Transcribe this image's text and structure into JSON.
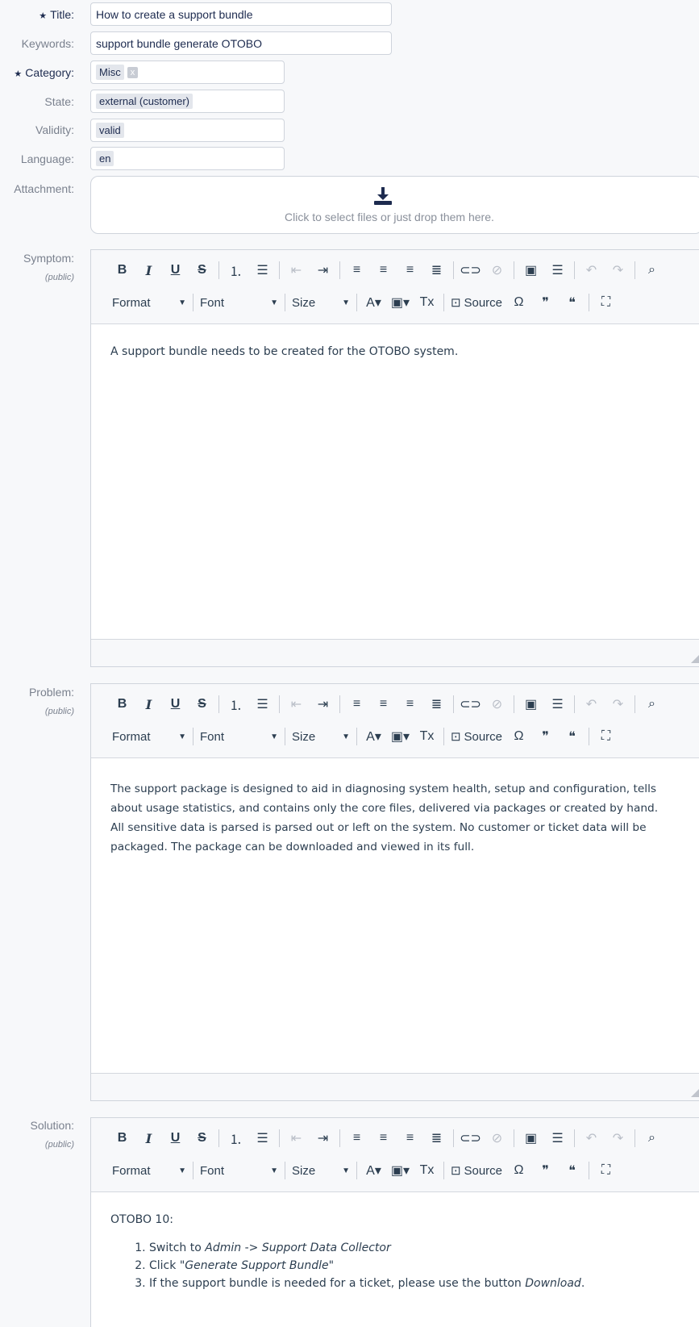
{
  "fields": {
    "title": {
      "label": "Title:",
      "required": true,
      "value": "How to create a support bundle"
    },
    "keywords": {
      "label": "Keywords:",
      "value": "support bundle generate OTOBO"
    },
    "category": {
      "label": "Category:",
      "required": true,
      "tag": "Misc",
      "remove": "x"
    },
    "state": {
      "label": "State:",
      "tag": "external (customer)"
    },
    "validity": {
      "label": "Validity:",
      "tag": "valid"
    },
    "language": {
      "label": "Language:",
      "tag": "en"
    },
    "attachment": {
      "label": "Attachment:",
      "hint": "Click to select files or just drop them here."
    }
  },
  "star": "★",
  "toolbar": {
    "format": "Format",
    "font": "Font",
    "size": "Size",
    "source": "Source",
    "bold": "B",
    "italic": "I",
    "underline": "U",
    "strike": "S",
    "omega": "Ω"
  },
  "editors": {
    "symptom": {
      "label": "Symptom:",
      "visibility": "(public)",
      "text": "A support bundle needs to be created for the OTOBO system."
    },
    "problem": {
      "label": "Problem:",
      "visibility": "(public)",
      "lines": [
        "The support package is designed to aid in diagnosing system health, setup and configuration, tells",
        "about usage statistics, and contains only the core files, delivered via packages or created by hand.",
        "All sensitive data is parsed is parsed out or left on the system. No customer or ticket data will be",
        "packaged. The package can be downloaded and viewed in its full."
      ]
    },
    "solution": {
      "label": "Solution:",
      "visibility": "(public)",
      "heading": "OTOBO 10:",
      "steps": [
        {
          "pre": "Switch to ",
          "em": "Admin",
          "mid": " -> ",
          "em2": "Support Data Collector",
          "post": ""
        },
        {
          "pre": "Click ",
          "em": "\"Generate Support Bundle\"",
          "mid": "",
          "em2": "",
          "post": ""
        },
        {
          "pre": "If the support bundle is needed for a ticket, please use the button ",
          "em": "Download",
          "mid": "",
          "em2": "",
          "post": "."
        }
      ]
    }
  },
  "colors": {
    "accent": "#1d2b4f",
    "border": "#cfd4dc",
    "background": "#f7f8fa"
  }
}
